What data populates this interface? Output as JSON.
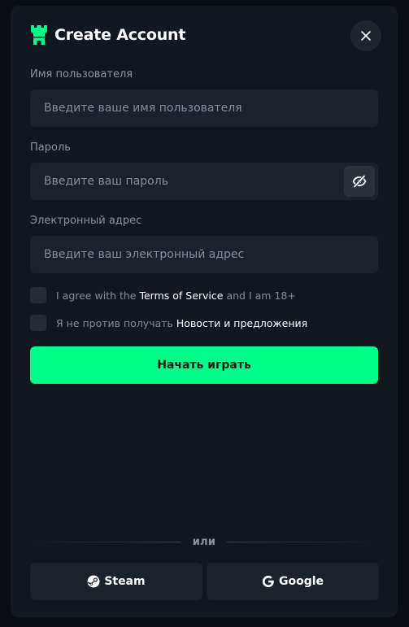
{
  "header": {
    "title": "Create Account",
    "logo_icon": "castle-tower-icon",
    "close_icon": "close-icon"
  },
  "fields": {
    "username": {
      "label": "Имя пользователя",
      "placeholder": "Введите ваше имя пользователя",
      "value": ""
    },
    "password": {
      "label": "Пароль",
      "placeholder": "Введите ваш пароль",
      "value": "",
      "toggle_icon": "eye-slash-icon"
    },
    "email": {
      "label": "Электронный адрес",
      "placeholder": "Введите ваш электронный адрес",
      "value": ""
    }
  },
  "checkboxes": {
    "terms": {
      "checked": false,
      "prefix": "I agree with the",
      "link": "Terms of Service",
      "suffix": "and I am 18+"
    },
    "news": {
      "checked": false,
      "prefix": "Я не против получать",
      "link": "Новости и предложения"
    }
  },
  "primary_button": {
    "label": "Начать играть"
  },
  "divider": {
    "label": "или"
  },
  "social": {
    "steam": {
      "label": "Steam",
      "icon": "steam-icon"
    },
    "google": {
      "label": "Google",
      "icon": "google-icon"
    }
  },
  "colors": {
    "accent": "#00fe8a",
    "panel": "#121820",
    "input_bg": "#1c222b"
  }
}
